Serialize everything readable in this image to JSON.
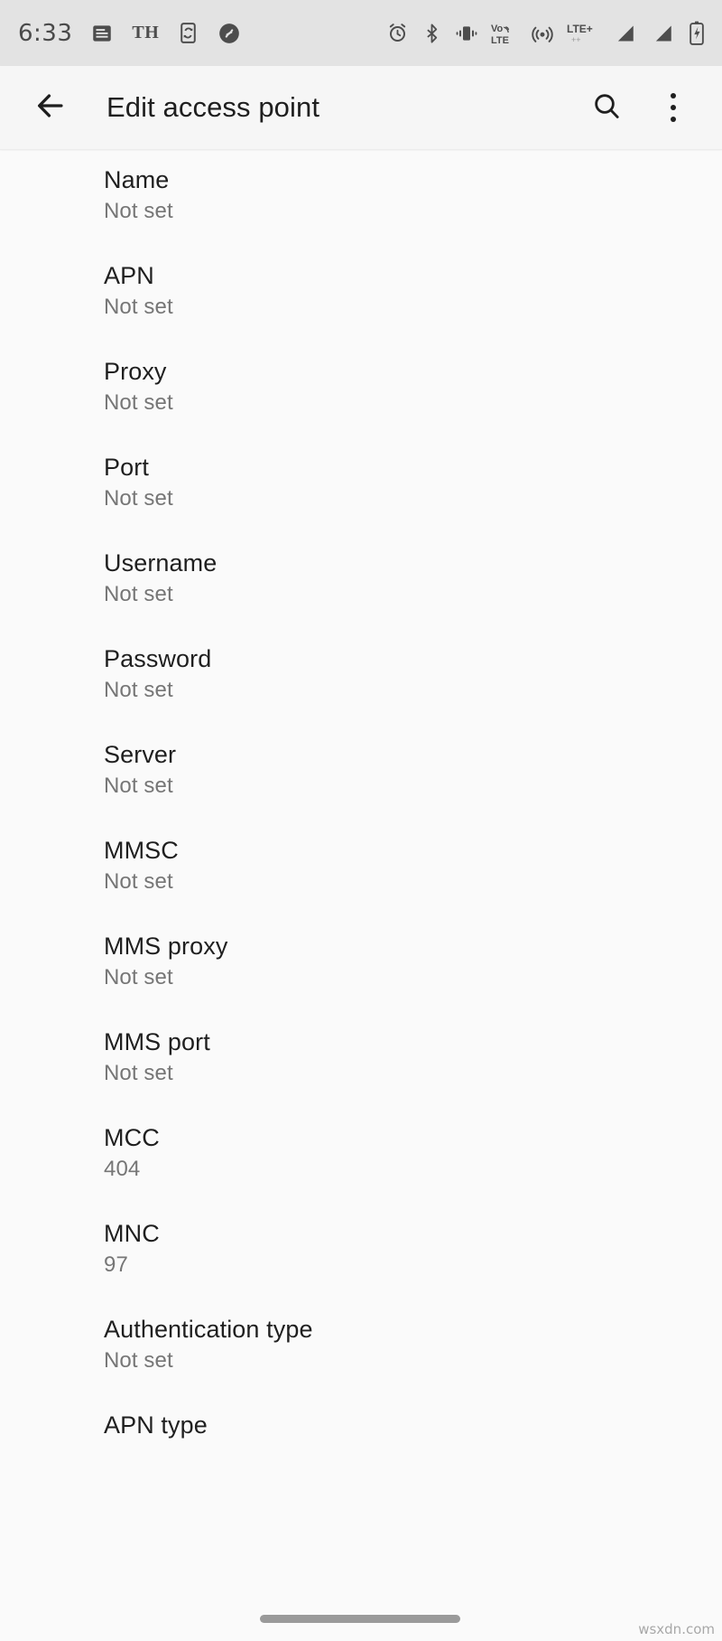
{
  "status_bar": {
    "time": "6:33",
    "left_icons": [
      {
        "name": "news-icon",
        "label": ""
      },
      {
        "name": "th-text-icon",
        "label": "TH"
      },
      {
        "name": "phone-sync-icon",
        "label": ""
      },
      {
        "name": "shazam-icon",
        "label": ""
      }
    ],
    "right_icons": [
      {
        "name": "alarm-icon"
      },
      {
        "name": "bluetooth-icon"
      },
      {
        "name": "vibrate-icon"
      },
      {
        "name": "volte-icon",
        "label": "VoLTE"
      },
      {
        "name": "hotspot-icon"
      },
      {
        "name": "lte-plus-icon",
        "label": "LTE+"
      },
      {
        "name": "signal-bars-sim1-icon"
      },
      {
        "name": "signal-bars-sim2-icon"
      },
      {
        "name": "battery-charging-icon"
      }
    ],
    "background_color": "#e3e3e3"
  },
  "app_bar": {
    "title": "Edit access point",
    "back_icon": "arrow-back-icon",
    "search_icon": "search-icon",
    "overflow_icon": "more-vert-icon",
    "background_color": "#f6f6f6"
  },
  "settings_list": {
    "not_set_text": "Not set",
    "items": [
      {
        "title": "Name",
        "value": "Not set"
      },
      {
        "title": "APN",
        "value": "Not set"
      },
      {
        "title": "Proxy",
        "value": "Not set"
      },
      {
        "title": "Port",
        "value": "Not set"
      },
      {
        "title": "Username",
        "value": "Not set"
      },
      {
        "title": "Password",
        "value": "Not set"
      },
      {
        "title": "Server",
        "value": "Not set"
      },
      {
        "title": "MMSC",
        "value": "Not set"
      },
      {
        "title": "MMS proxy",
        "value": "Not set"
      },
      {
        "title": "MMS port",
        "value": "Not set"
      },
      {
        "title": "MCC",
        "value": "404"
      },
      {
        "title": "MNC",
        "value": "97"
      },
      {
        "title": "Authentication type",
        "value": "Not set"
      },
      {
        "title": "APN type",
        "value": ""
      }
    ]
  },
  "navigation": {
    "home_indicator": "home-gesture-bar"
  },
  "watermark": {
    "text": "wsxdn.com"
  },
  "colors": {
    "page_background": "#fafafa",
    "status_bar": "#e3e3e3",
    "app_bar": "#f6f6f6",
    "primary_text": "#1f1f1f",
    "secondary_text": "#767676",
    "icon": "#4d4d4d"
  }
}
